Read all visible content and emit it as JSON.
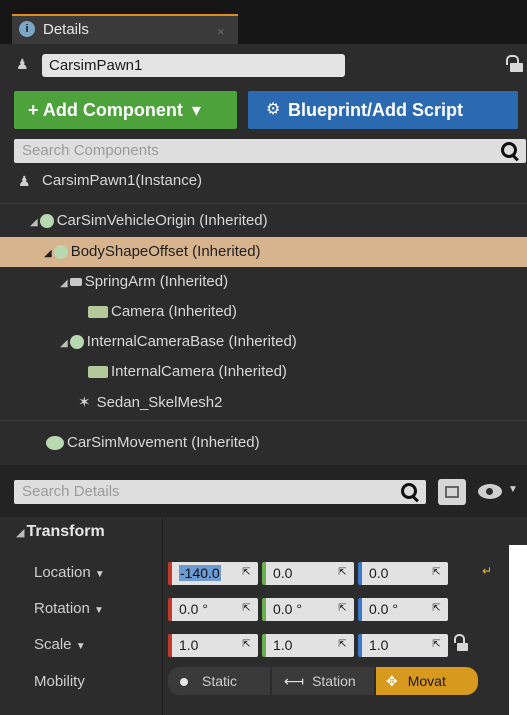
{
  "tab": {
    "title": "Details",
    "close": "×"
  },
  "actor": {
    "name": "CarsimPawn1"
  },
  "toolbar": {
    "add_label": "+ Add Component",
    "add_arrow": "▾",
    "blueprint_label": "Blueprint/Add Script"
  },
  "search_components": {
    "placeholder": "Search Components"
  },
  "instance": {
    "label": "CarsimPawn1(Instance)"
  },
  "tree": [
    {
      "label": "CarSimVehicleOrigin (Inherited)"
    },
    {
      "label": "BodyShapeOffset (Inherited)"
    },
    {
      "label": "SpringArm (Inherited)"
    },
    {
      "label": "Camera (Inherited)"
    },
    {
      "label": "InternalCameraBase (Inherited)"
    },
    {
      "label": "InternalCamera (Inherited)"
    },
    {
      "label": "Sedan_SkelMesh2"
    },
    {
      "label": "CarSimMovement (Inherited)"
    }
  ],
  "search_details": {
    "placeholder": "Search Details"
  },
  "transform": {
    "section": "Transform",
    "location": {
      "label": "Location",
      "x": "-140.0",
      "y": "0.0",
      "z": "0.0"
    },
    "rotation": {
      "label": "Rotation",
      "x": "0.0 °",
      "y": "0.0 °",
      "z": "0.0 °"
    },
    "scale": {
      "label": "Scale",
      "x": "1.0",
      "y": "1.0",
      "z": "1.0"
    },
    "mobility": {
      "label": "Mobility",
      "static": "Static",
      "stationary": "Station",
      "movable": "Movat"
    }
  },
  "colors": {
    "add_button": "#4da23b",
    "blueprint_button": "#2b6ab0",
    "selected_row": "#d8b48e",
    "movable": "#d89a1e"
  },
  "icons": [
    "info-icon",
    "actor-icon",
    "lock-icon",
    "search-icon",
    "grid-view-icon",
    "eye-icon",
    "scene-component-icon",
    "spring-arm-icon",
    "camera-icon",
    "skeletal-mesh-icon",
    "movement-component-icon",
    "reset-arrow-icon"
  ]
}
